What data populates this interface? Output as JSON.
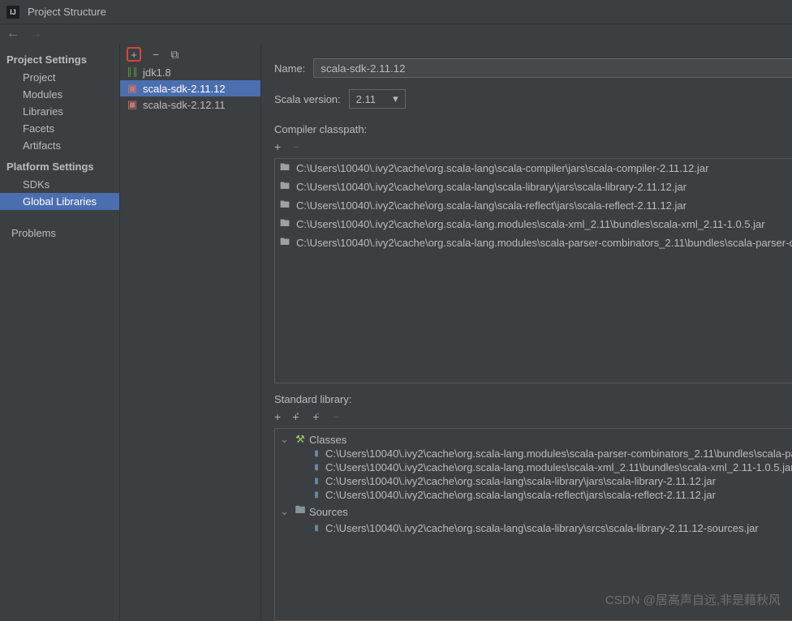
{
  "window": {
    "title": "Project Structure"
  },
  "leftPanel": {
    "projectHeader": "Project Settings",
    "projectItems": [
      "Project",
      "Modules",
      "Libraries",
      "Facets",
      "Artifacts"
    ],
    "platformHeader": "Platform Settings",
    "platformItems": [
      "SDKs",
      "Global Libraries"
    ],
    "problems": "Problems"
  },
  "libraries": {
    "items": [
      {
        "name": "jdk1.8",
        "kind": "jdk"
      },
      {
        "name": "scala-sdk-2.11.12",
        "kind": "scala",
        "selected": true
      },
      {
        "name": "scala-sdk-2.12.11",
        "kind": "scala"
      }
    ]
  },
  "form": {
    "nameLabel": "Name:",
    "nameValue": "scala-sdk-2.11.12",
    "scalaVersionLabel": "Scala version:",
    "scalaVersionValue": "2.11",
    "compilerClasspathLabel": "Compiler classpath:",
    "classpath": [
      "C:\\Users\\10040\\.ivy2\\cache\\org.scala-lang\\scala-compiler\\jars\\scala-compiler-2.11.12.jar",
      "C:\\Users\\10040\\.ivy2\\cache\\org.scala-lang\\scala-library\\jars\\scala-library-2.11.12.jar",
      "C:\\Users\\10040\\.ivy2\\cache\\org.scala-lang\\scala-reflect\\jars\\scala-reflect-2.11.12.jar",
      "C:\\Users\\10040\\.ivy2\\cache\\org.scala-lang.modules\\scala-xml_2.11\\bundles\\scala-xml_2.11-1.0.5.jar",
      "C:\\Users\\10040\\.ivy2\\cache\\org.scala-lang.modules\\scala-parser-combinators_2.11\\bundles\\scala-parser-co"
    ],
    "stdLibLabel": "Standard library:",
    "classesLabel": "Classes",
    "sourcesLabel": "Sources",
    "classes": [
      "C:\\Users\\10040\\.ivy2\\cache\\org.scala-lang.modules\\scala-parser-combinators_2.11\\bundles\\scala-pa",
      "C:\\Users\\10040\\.ivy2\\cache\\org.scala-lang.modules\\scala-xml_2.11\\bundles\\scala-xml_2.11-1.0.5.jar",
      "C:\\Users\\10040\\.ivy2\\cache\\org.scala-lang\\scala-library\\jars\\scala-library-2.11.12.jar",
      "C:\\Users\\10040\\.ivy2\\cache\\org.scala-lang\\scala-reflect\\jars\\scala-reflect-2.11.12.jar"
    ],
    "sources": [
      "C:\\Users\\10040\\.ivy2\\cache\\org.scala-lang\\scala-library\\srcs\\scala-library-2.11.12-sources.jar"
    ]
  },
  "watermark": "CSDN @居高声自远,非是藉秋风"
}
